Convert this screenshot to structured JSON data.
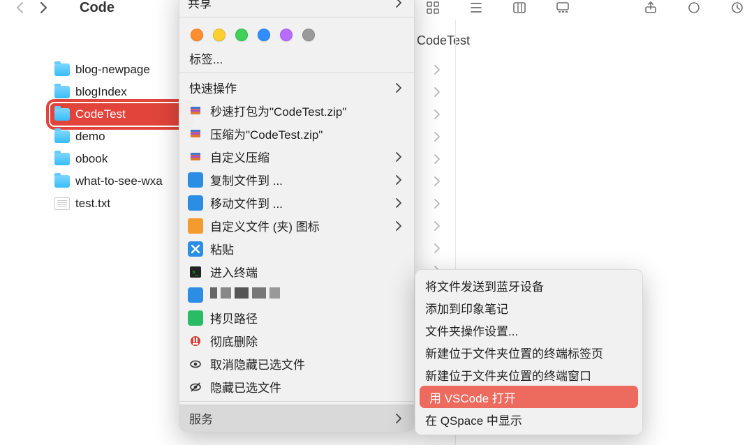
{
  "toolbar": {
    "breadcrumb_partial": "Code"
  },
  "column_title": "CodeTest",
  "files": [
    {
      "name": "blog-newpage",
      "kind": "folder"
    },
    {
      "name": "blogIndex",
      "kind": "folder"
    },
    {
      "name": "CodeTest",
      "kind": "folder",
      "selected": true
    },
    {
      "name": "demo",
      "kind": "folder"
    },
    {
      "name": "obook",
      "kind": "folder"
    },
    {
      "name": "what-to-see-wxa",
      "kind": "folder"
    },
    {
      "name": "test.txt",
      "kind": "file"
    }
  ],
  "tag_colors": [
    "#ff8f2e",
    "#ffd02e",
    "#3fd158",
    "#2f8dff",
    "#b86cff",
    "#9a9a9a"
  ],
  "menu": {
    "share": "共享",
    "tags_label": "标签...",
    "quick_actions": "快速操作",
    "items": [
      {
        "label": "秒速打包为\"CodeTest.zip\""
      },
      {
        "label": "压缩为\"CodeTest.zip\""
      },
      {
        "label": "自定义压缩",
        "sub": true
      },
      {
        "label": "复制文件到 ...",
        "sub": true
      },
      {
        "label": "移动文件到 ...",
        "sub": true
      },
      {
        "label": "自定义文件 (夹) 图标",
        "sub": true
      },
      {
        "label": "粘贴"
      },
      {
        "label": "进入终端"
      },
      {
        "label": "",
        "pixelated": true
      },
      {
        "label": "拷贝路径"
      },
      {
        "label": "彻底删除"
      },
      {
        "label": "取消隐藏已选文件"
      },
      {
        "label": "隐藏已选文件"
      }
    ],
    "services": "服务"
  },
  "submenu": {
    "items": [
      "将文件发送到蓝牙设备",
      "添加到印象笔记",
      "文件夹操作设置...",
      "新建位于文件夹位置的终端标签页",
      "新建位于文件夹位置的终端窗口",
      "用 VSCode 打开",
      "在 QSpace 中显示"
    ],
    "highlight_index": 5
  }
}
